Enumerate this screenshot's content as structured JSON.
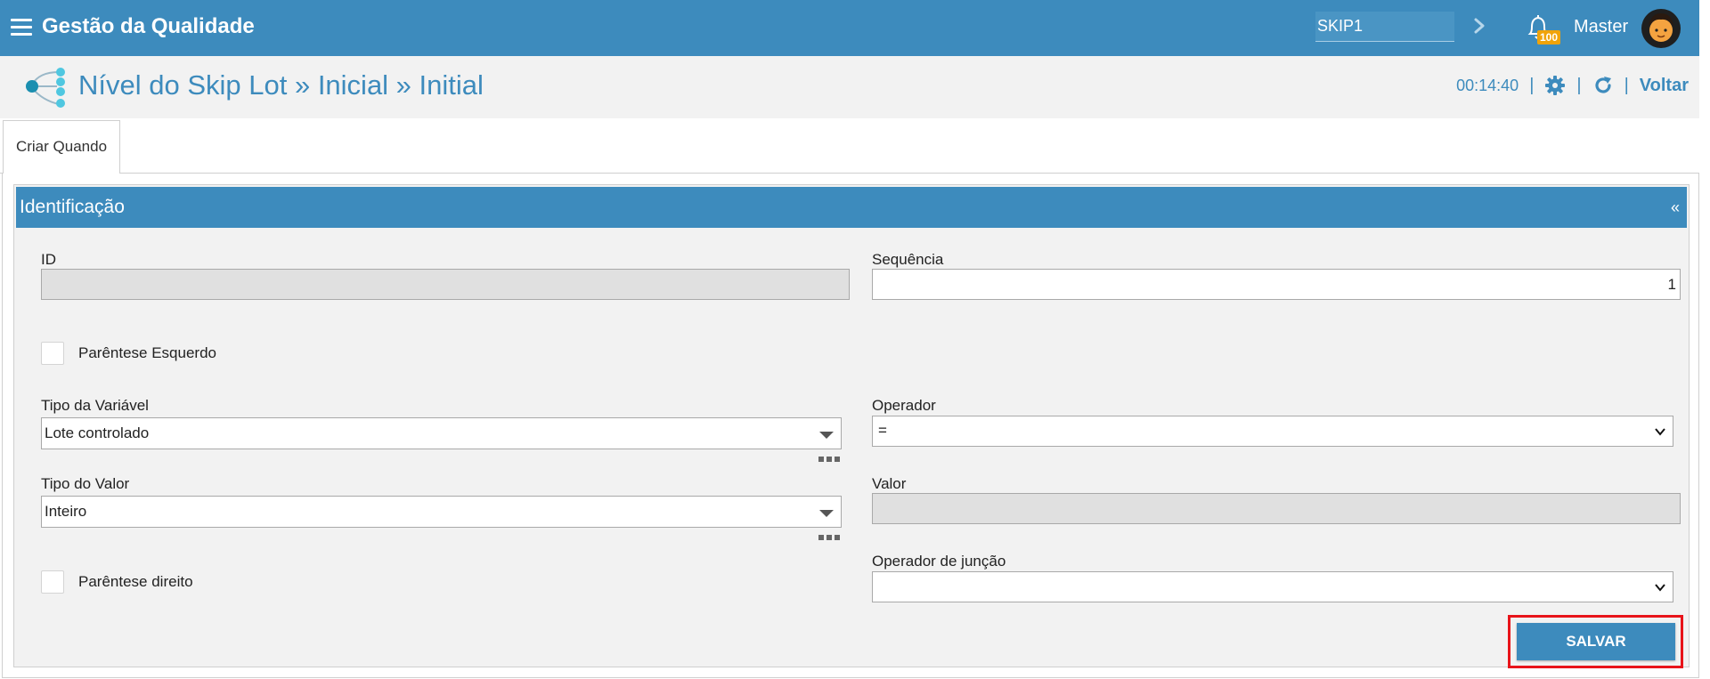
{
  "app": {
    "title": "Gestão da Qualidade",
    "search_value": "SKIP1",
    "notification_count": "100",
    "user_name": "Master"
  },
  "header": {
    "title": "Nível do Skip Lot » Inicial » Initial",
    "timer": "00:14:40",
    "back_label": "Voltar"
  },
  "tabs": [
    {
      "label": "Criar Quando",
      "active": true
    }
  ],
  "panel": {
    "title": "Identificação",
    "collapse_symbol": "«"
  },
  "form": {
    "id": {
      "label": "ID",
      "value": ""
    },
    "sequencia": {
      "label": "Sequência",
      "value": "1"
    },
    "parentese_esquerdo": {
      "label": "Parêntese Esquerdo",
      "checked": false
    },
    "tipo_variavel": {
      "label": "Tipo da Variável",
      "value": "Lote controlado"
    },
    "operador": {
      "label": "Operador",
      "value": "="
    },
    "tipo_valor": {
      "label": "Tipo do Valor",
      "value": "Inteiro"
    },
    "valor": {
      "label": "Valor",
      "value": ""
    },
    "parentese_direito": {
      "label": "Parêntese direito",
      "checked": false
    },
    "operador_juncao": {
      "label": "Operador de junção",
      "value": ""
    },
    "save_label": "SALVAR"
  },
  "colors": {
    "primary": "#3d8bbd",
    "badge": "#f0a30a",
    "highlight": "#e8141a",
    "panel_bg": "#f2f2f2"
  },
  "icons": {
    "menu": "hamburger-icon",
    "search_go": "chevron-right-icon",
    "notifications": "bell-icon",
    "page": "workflow-icon",
    "settings": "gear-icon",
    "refresh": "refresh-icon",
    "more": "ellipsis-icon"
  }
}
